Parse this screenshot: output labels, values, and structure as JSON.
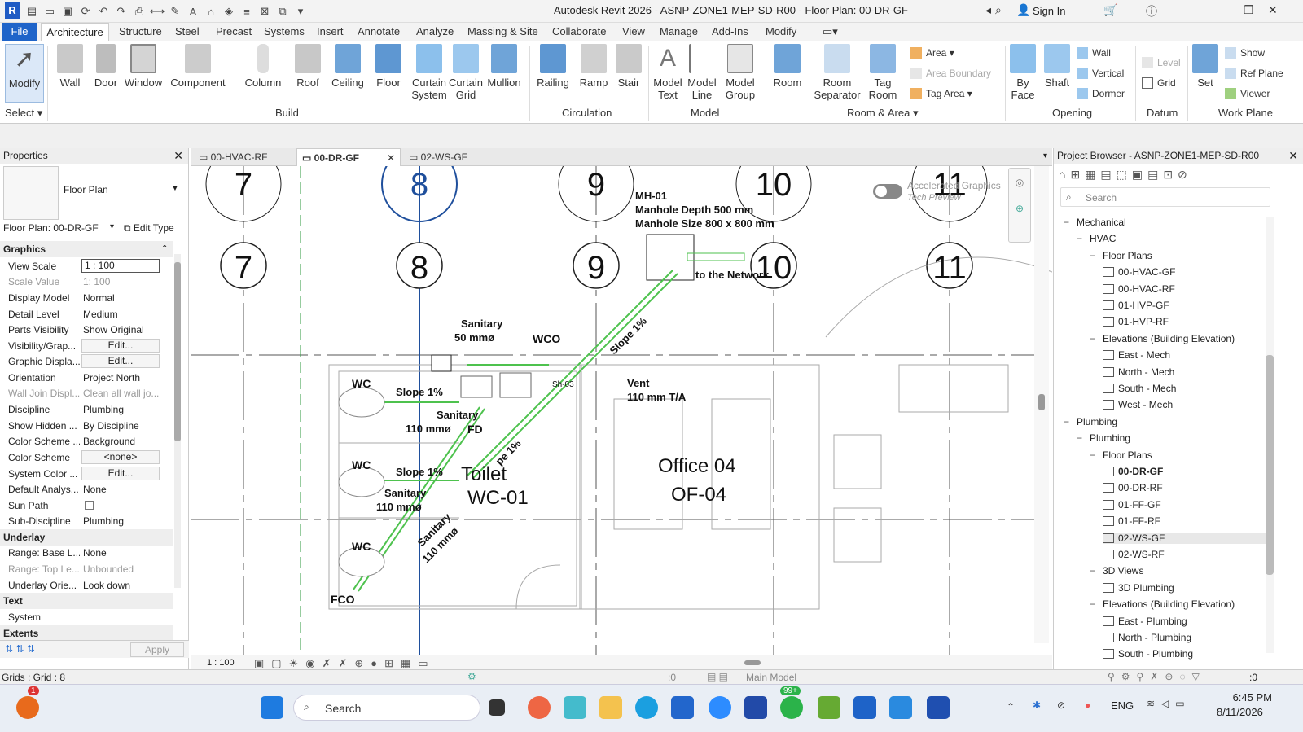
{
  "window": {
    "title": "Autodesk Revit 2026 - ASNP-ZONE1-MEP-SD-R00 - Floor Plan: 00-DR-GF",
    "sign_in": "Sign In"
  },
  "tabs": [
    "File",
    "Architecture",
    "Structure",
    "Steel",
    "Precast",
    "Systems",
    "Insert",
    "Annotate",
    "Analyze",
    "Massing & Site",
    "Collaborate",
    "View",
    "Manage",
    "Add-Ins",
    "Modify"
  ],
  "ribbon": {
    "modify": "Modify",
    "build": [
      "Wall",
      "Door",
      "Window",
      "Component",
      "Column",
      "Roof",
      "Ceiling",
      "Floor",
      "Curtain System",
      "Curtain Grid",
      "Mullion"
    ],
    "circulation": [
      "Railing",
      "Ramp",
      "Stair"
    ],
    "model": [
      "Model Text",
      "Model Line",
      "Model Group"
    ],
    "room": [
      "Room",
      "Room Separator",
      "Tag Room"
    ],
    "room_small": [
      "Area",
      "Area Boundary",
      "Tag Area"
    ],
    "opening_big": [
      "By Face",
      "Shaft"
    ],
    "opening_small": [
      "Wall",
      "Vertical",
      "Dormer"
    ],
    "datum": [
      "Level",
      "Grid"
    ],
    "workplane_big": "Set",
    "workplane_small": [
      "Show",
      "Ref Plane",
      "Viewer"
    ],
    "groups": [
      "Select",
      "Build",
      "Circulation",
      "Model",
      "Room & Area",
      "Opening",
      "Datum",
      "Work Plane"
    ]
  },
  "properties": {
    "title": "Properties",
    "type": "Floor Plan",
    "instance": "Floor Plan: 00-DR-GF",
    "edit_type": "Edit Type",
    "sections": {
      "graphics": "Graphics",
      "underlay": "Underlay",
      "text": "Text",
      "extents": "Extents"
    },
    "rows": [
      {
        "k": "View Scale",
        "v": "1 : 100"
      },
      {
        "k": "Scale Value",
        "v": "1:    100"
      },
      {
        "k": "Display Model",
        "v": "Normal"
      },
      {
        "k": "Detail Level",
        "v": "Medium"
      },
      {
        "k": "Parts Visibility",
        "v": "Show Original"
      },
      {
        "k": "Visibility/Grap...",
        "v": "Edit..."
      },
      {
        "k": "Graphic Displa...",
        "v": "Edit..."
      },
      {
        "k": "Orientation",
        "v": "Project North"
      },
      {
        "k": "Wall Join Displ...",
        "v": "Clean all wall jo..."
      },
      {
        "k": "Discipline",
        "v": "Plumbing"
      },
      {
        "k": "Show Hidden ...",
        "v": "By Discipline"
      },
      {
        "k": "Color Scheme ...",
        "v": "Background"
      },
      {
        "k": "Color Scheme",
        "v": "<none>"
      },
      {
        "k": "System Color ...",
        "v": "Edit..."
      },
      {
        "k": "Default Analys...",
        "v": "None"
      },
      {
        "k": "Sun Path",
        "v": ""
      },
      {
        "k": "Sub-Discipline",
        "v": "Plumbing"
      },
      {
        "k": "Range: Base L...",
        "v": "None"
      },
      {
        "k": "Range: Top Le...",
        "v": "Unbounded"
      },
      {
        "k": "Underlay Orie...",
        "v": "Look down"
      },
      {
        "k": "System",
        "v": ""
      }
    ],
    "apply": "Apply"
  },
  "view_tabs": [
    "00-HVAC-RF",
    "00-DR-GF",
    "02-WS-GF"
  ],
  "drawing": {
    "grid_labels": [
      "7",
      "8",
      "9",
      "10",
      "11"
    ],
    "mh_title": "MH-01",
    "mh_depth": "Manhole Depth 500 mm",
    "mh_size": "Manhole Size 800 x 800 mm",
    "to_network": "to the Network",
    "toggle_label": "Accelerated Graphics",
    "toggle_sub": "Tech Preview",
    "sanitary50": "Sanitary",
    "sanitary50b": "50 mmø",
    "wco": "WCO",
    "slope": "Slope 1%",
    "slope_short": "Slope 1%",
    "wc": "WC",
    "sanitary110": "Sanitary",
    "sanitary110b": "110 mmø",
    "fd": "FD",
    "sh": "Sh-03",
    "vent": "Vent",
    "vent_size": "110 mm T/A",
    "room1": "Toilet",
    "room1_no": "WC-01",
    "room2": "Office 04",
    "room2_no": "OF-04",
    "fco": "FCO",
    "pe": "pe 1%"
  },
  "view_control": {
    "scale": "1 : 100"
  },
  "browser": {
    "title": "Project Browser - ASNP-ZONE1-MEP-SD-R00",
    "search": "Search",
    "items": [
      {
        "t": "Mechanical",
        "lvl": 0,
        "tg": "−"
      },
      {
        "t": "HVAC",
        "lvl": 1,
        "tg": "−"
      },
      {
        "t": "Floor Plans",
        "lvl": 2,
        "tg": "−"
      },
      {
        "t": "00-HVAC-GF",
        "lvl": 3,
        "view": true
      },
      {
        "t": "00-HVAC-RF",
        "lvl": 3,
        "view": true
      },
      {
        "t": "01-HVP-GF",
        "lvl": 3,
        "view": true
      },
      {
        "t": "01-HVP-RF",
        "lvl": 3,
        "view": true
      },
      {
        "t": "Elevations (Building Elevation)",
        "lvl": 2,
        "tg": "−"
      },
      {
        "t": "East - Mech",
        "lvl": 3,
        "view": true
      },
      {
        "t": "North - Mech",
        "lvl": 3,
        "view": true
      },
      {
        "t": "South - Mech",
        "lvl": 3,
        "view": true
      },
      {
        "t": "West - Mech",
        "lvl": 3,
        "view": true
      },
      {
        "t": "Plumbing",
        "lvl": 0,
        "tg": "−"
      },
      {
        "t": "Plumbing",
        "lvl": 1,
        "tg": "−"
      },
      {
        "t": "Floor Plans",
        "lvl": 2,
        "tg": "−"
      },
      {
        "t": "00-DR-GF",
        "lvl": 3,
        "view": true,
        "bold": true
      },
      {
        "t": "00-DR-RF",
        "lvl": 3,
        "view": true
      },
      {
        "t": "01-FF-GF",
        "lvl": 3,
        "view": true
      },
      {
        "t": "01-FF-RF",
        "lvl": 3,
        "view": true
      },
      {
        "t": "02-WS-GF",
        "lvl": 3,
        "view": true,
        "hl": true
      },
      {
        "t": "02-WS-RF",
        "lvl": 3,
        "view": true
      },
      {
        "t": "3D Views",
        "lvl": 2,
        "tg": "−"
      },
      {
        "t": "3D Plumbing",
        "lvl": 3,
        "view": true
      },
      {
        "t": "Elevations (Building Elevation)",
        "lvl": 2,
        "tg": "−"
      },
      {
        "t": "East - Plumbing",
        "lvl": 3,
        "view": true
      },
      {
        "t": "North - Plumbing",
        "lvl": 3,
        "view": true
      },
      {
        "t": "South - Plumbing",
        "lvl": 3,
        "view": true
      }
    ]
  },
  "status": {
    "left": "Grids : Grid : 8",
    "model": "Main Model",
    "count": ":0"
  },
  "taskbar": {
    "search": "Search",
    "time": "6:45 PM",
    "date": "8/11/2026",
    "lang": "ENG",
    "badge": "99+",
    "notif": "1"
  }
}
